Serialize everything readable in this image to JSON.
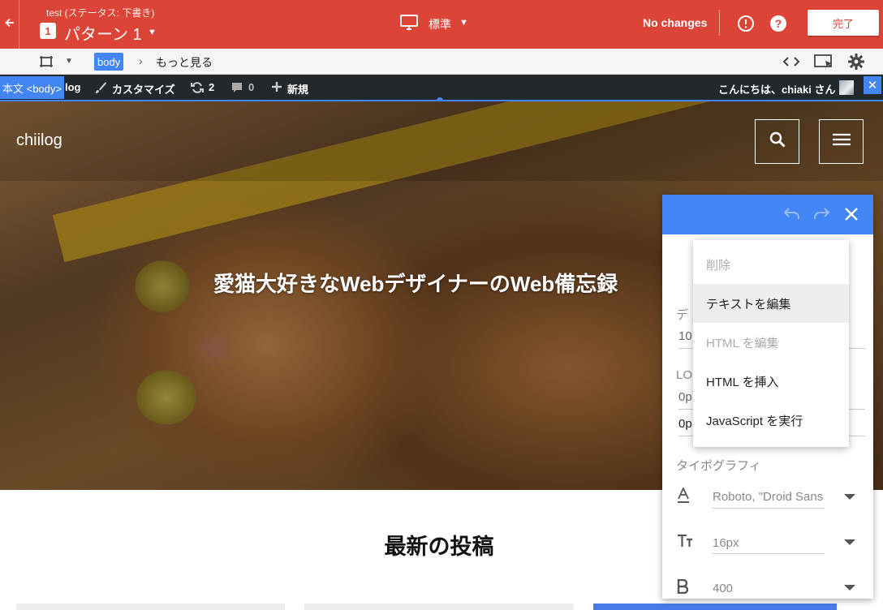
{
  "topbar": {
    "subtitle": "test (ステータス: 下書き)",
    "variant_number": "1",
    "variant_title": "パターン 1",
    "device_label": "標準",
    "status": "No changes",
    "done_label": "完了",
    "accent": "#db4437"
  },
  "toolbar": {
    "selected_element": "body",
    "more_label": "もっと見る"
  },
  "wp_admin_bar": {
    "element_tag": "本文 <body>",
    "site_name": "log",
    "customize_label": "カスタマイズ",
    "updates_count": "2",
    "comments_count": "0",
    "new_label": "新規",
    "greeting": "こんにちは、chiaki さん"
  },
  "site": {
    "title": "chiilog",
    "hero_heading": "愛猫大好きなWebデザイナーのWeb備忘録",
    "section_title": "最新の投稿"
  },
  "panel": {
    "label_design": "デ",
    "value_design": "10",
    "label_logo": "LO",
    "value_logo1": "0p",
    "value_logo2": "0p",
    "typography_label": "タイポグラフィ",
    "font_family": "Roboto, \"Droid Sans",
    "font_size": "16px",
    "font_weight": "400",
    "accent": "#4285f4"
  },
  "context_menu": {
    "items": [
      {
        "label": "削除",
        "state": "disabled"
      },
      {
        "label": "テキストを編集",
        "state": "active"
      },
      {
        "label": "HTML を編集",
        "state": "disabled"
      },
      {
        "label": "HTML を挿入",
        "state": "normal"
      },
      {
        "label": "JavaScript を実行",
        "state": "normal"
      }
    ]
  }
}
